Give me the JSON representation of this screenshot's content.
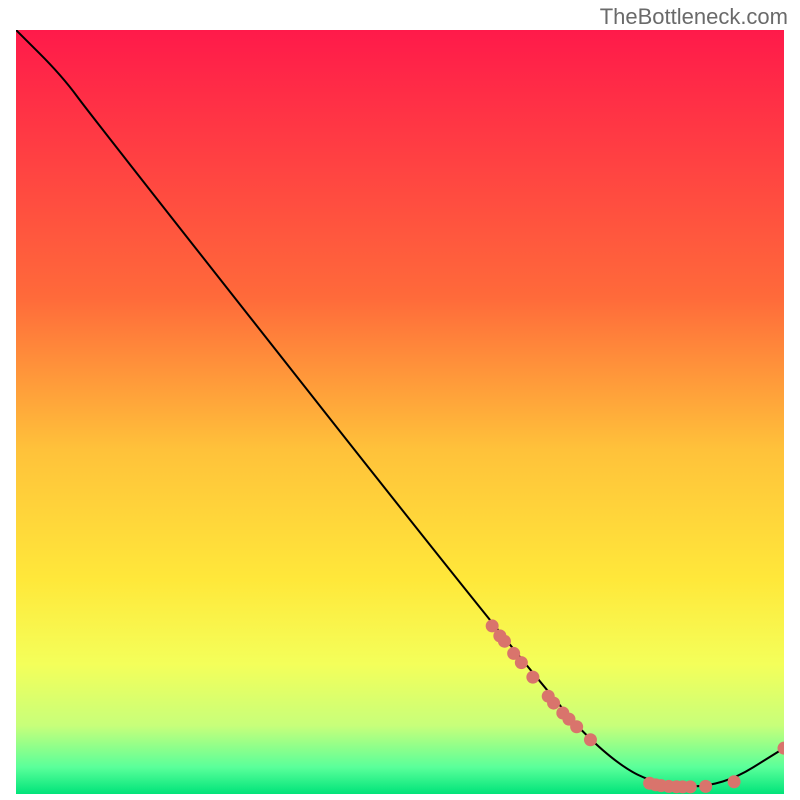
{
  "attribution": "TheBottleneck.com",
  "chart_data": {
    "type": "line",
    "title": "",
    "xlabel": "",
    "ylabel": "",
    "xlim": [
      0,
      100
    ],
    "ylim": [
      0,
      100
    ],
    "gradient_stops": [
      {
        "offset": 0,
        "color": "#ff1a4a"
      },
      {
        "offset": 35,
        "color": "#ff6a3a"
      },
      {
        "offset": 55,
        "color": "#ffc23a"
      },
      {
        "offset": 72,
        "color": "#ffe83a"
      },
      {
        "offset": 83,
        "color": "#f4ff5a"
      },
      {
        "offset": 91,
        "color": "#c8ff7a"
      },
      {
        "offset": 96.5,
        "color": "#5aff9a"
      },
      {
        "offset": 100,
        "color": "#00e47a"
      }
    ],
    "curve": [
      {
        "x": 0,
        "y": 100
      },
      {
        "x": 6,
        "y": 94
      },
      {
        "x": 10,
        "y": 88.5
      },
      {
        "x": 70,
        "y": 12
      },
      {
        "x": 78,
        "y": 4
      },
      {
        "x": 84,
        "y": 1
      },
      {
        "x": 92,
        "y": 1
      },
      {
        "x": 100,
        "y": 6
      }
    ],
    "dots": [
      {
        "x": 62,
        "y": 22.0
      },
      {
        "x": 63,
        "y": 20.7
      },
      {
        "x": 63.6,
        "y": 20.0
      },
      {
        "x": 64.8,
        "y": 18.4
      },
      {
        "x": 65.8,
        "y": 17.2
      },
      {
        "x": 67.3,
        "y": 15.3
      },
      {
        "x": 69.3,
        "y": 12.8
      },
      {
        "x": 70.0,
        "y": 11.9
      },
      {
        "x": 71.2,
        "y": 10.6
      },
      {
        "x": 72.0,
        "y": 9.8
      },
      {
        "x": 73.0,
        "y": 8.8
      },
      {
        "x": 74.8,
        "y": 7.1
      },
      {
        "x": 82.5,
        "y": 1.4
      },
      {
        "x": 83.3,
        "y": 1.2
      },
      {
        "x": 84.0,
        "y": 1.1
      },
      {
        "x": 85.0,
        "y": 1.0
      },
      {
        "x": 86.0,
        "y": 0.95
      },
      {
        "x": 86.8,
        "y": 0.93
      },
      {
        "x": 87.8,
        "y": 0.93
      },
      {
        "x": 89.8,
        "y": 1.0
      },
      {
        "x": 93.5,
        "y": 1.6
      },
      {
        "x": 100,
        "y": 6
      }
    ],
    "dot_color": "#d9746c",
    "line_color": "#000000"
  }
}
